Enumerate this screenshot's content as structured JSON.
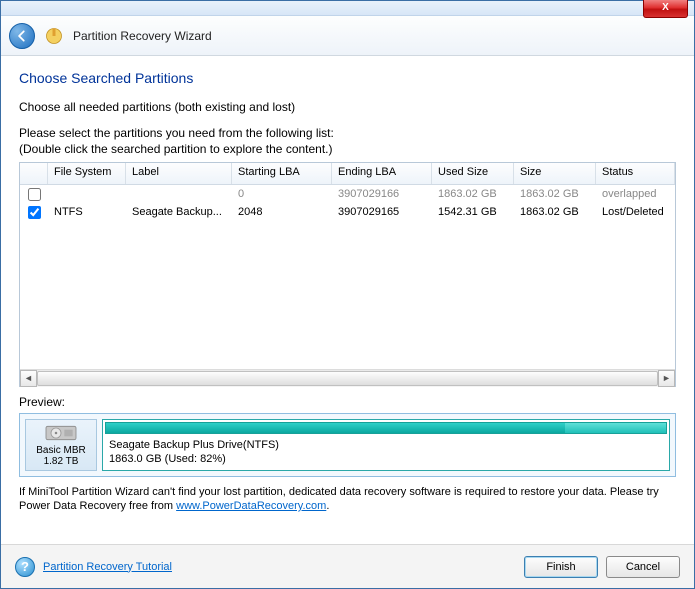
{
  "header": {
    "title": "Partition Recovery Wizard"
  },
  "page": {
    "title": "Choose Searched Partitions",
    "instr1": "Choose all needed partitions (both existing and lost)",
    "instr2": "Please select the partitions you need from the following list:",
    "instr3": "(Double click the searched partition to explore the content.)"
  },
  "grid": {
    "headers": {
      "fs": "File System",
      "label": "Label",
      "slba": "Starting LBA",
      "elba": "Ending LBA",
      "used": "Used Size",
      "size": "Size",
      "status": "Status"
    },
    "rows": [
      {
        "checked": false,
        "fs": "",
        "label": "",
        "slba": "0",
        "elba": "3907029166",
        "used": "1863.02 GB",
        "size": "1863.02 GB",
        "status": "overlapped"
      },
      {
        "checked": true,
        "fs": "NTFS",
        "label": "Seagate Backup...",
        "slba": "2048",
        "elba": "3907029165",
        "used": "1542.31 GB",
        "size": "1863.02 GB",
        "status": "Lost/Deleted"
      }
    ]
  },
  "preview": {
    "label": "Preview:",
    "disk": {
      "name": "Basic MBR",
      "size": "1.82 TB"
    },
    "partition": {
      "line1": "Seagate Backup Plus Drive(NTFS)",
      "line2": "1863.0 GB (Used: 82%)"
    }
  },
  "note": {
    "text1": "If MiniTool Partition Wizard can't find your lost partition, dedicated data recovery software is required to restore your data. Please try Power Data Recovery free from ",
    "link": "www.PowerDataRecovery.com",
    "text2": "."
  },
  "footer": {
    "tutorial": "Partition Recovery Tutorial",
    "finish": "Finish",
    "cancel": "Cancel"
  }
}
